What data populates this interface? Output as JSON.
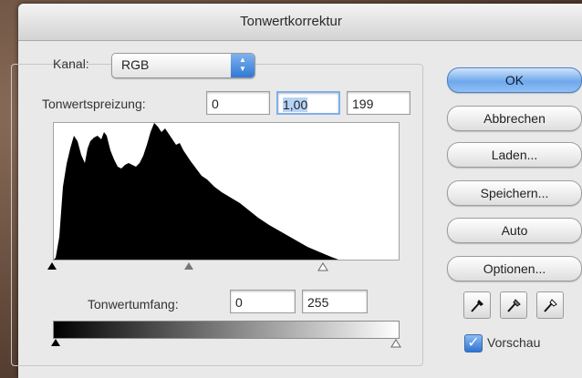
{
  "dialog": {
    "title": "Tonwertkorrektur"
  },
  "channel": {
    "label": "Kanal:",
    "value": "RGB"
  },
  "input_levels": {
    "label": "Tonwertspreizung:",
    "black": "0",
    "gamma": "1,00",
    "white": "199"
  },
  "output_levels": {
    "label": "Tonwertumfang:",
    "black": "0",
    "white": "255"
  },
  "buttons": {
    "ok": "OK",
    "cancel": "Abbrechen",
    "load": "Laden...",
    "save": "Speichern...",
    "auto": "Auto",
    "options": "Optionen..."
  },
  "preview": {
    "label": "Vorschau",
    "checked": true
  },
  "icons": {
    "channel_stepper": "up-down-arrows-icon",
    "black_eyedropper": "eyedropper-black-icon",
    "gray_eyedropper": "eyedropper-gray-icon",
    "white_eyedropper": "eyedropper-white-icon"
  },
  "colors": {
    "default_button": "#6fa8ec",
    "focus_ring": "#7fb0ea",
    "checkbox": "#2e74d4"
  }
}
